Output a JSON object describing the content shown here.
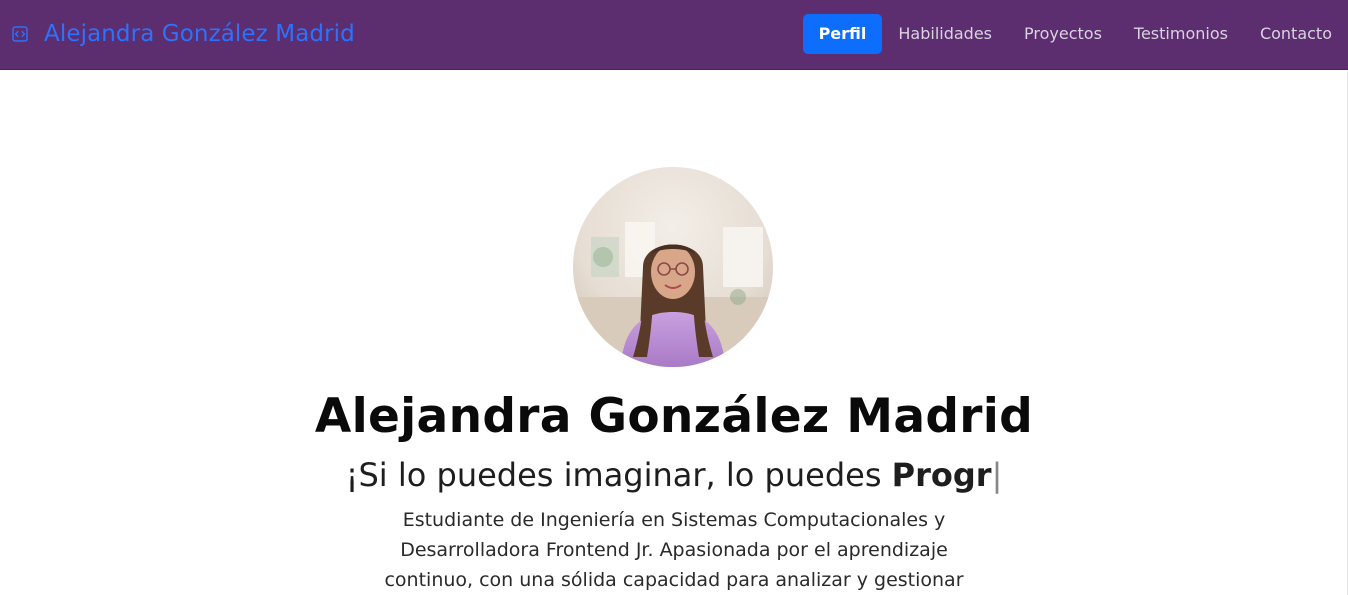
{
  "navbar": {
    "brand": "Alejandra González Madrid",
    "brand_icon": "code-icon",
    "links": [
      {
        "label": "Perfil",
        "active": true
      },
      {
        "label": "Habilidades",
        "active": false
      },
      {
        "label": "Proyectos",
        "active": false
      },
      {
        "label": "Testimonios",
        "active": false
      },
      {
        "label": "Contacto",
        "active": false
      }
    ],
    "colors": {
      "background": "#5c2d6f",
      "brand": "#2b73ff",
      "active_pill": "#0d6efd",
      "link": "#d9d3df"
    }
  },
  "hero": {
    "name": "Alejandra González Madrid",
    "tagline_prefix": "¡Si lo puedes imaginar, lo puedes ",
    "tagline_typed": "Progr",
    "tagline_cursor": "|",
    "bio": "Estudiante de Ingeniería en Sistemas Computacionales y Desarrolladora Frontend Jr. Apasionada por el aprendizaje continuo, con una sólida capacidad para analizar y gestionar"
  }
}
